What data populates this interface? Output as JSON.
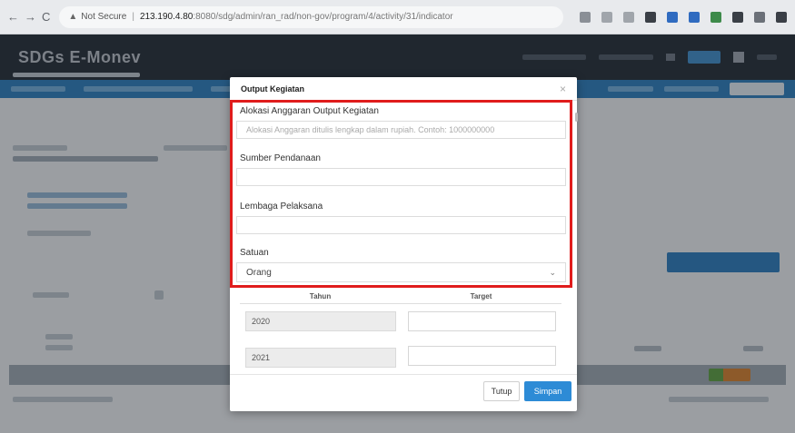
{
  "browser": {
    "back": "←",
    "forward": "→",
    "reload": "C",
    "security_label": "Not Secure",
    "host": "213.190.4.80",
    "path": ":8080/sdg/admin/ran_rad/non-gov/program/4/activity/31/indicator"
  },
  "app": {
    "brand": "SDGs E-Monev"
  },
  "modal": {
    "title": "Output Kegiatan",
    "close_icon": "×",
    "fields": {
      "alokasi_label": "Alokasi Anggaran Output Kegiatan",
      "alokasi_placeholder": "Alokasi Anggaran ditulis lengkap dalam rupiah. Contoh: 1000000000",
      "sumber_label": "Sumber Pendanaan",
      "lembaga_label": "Lembaga Pelaksana",
      "satuan_label": "Satuan",
      "satuan_value": "Orang"
    },
    "table": {
      "col_tahun": "Tahun",
      "col_target": "Target",
      "rows": [
        {
          "tahun": "2020"
        },
        {
          "tahun": "2021"
        }
      ]
    },
    "buttons": {
      "tutup": "Tutup",
      "simpan": "Simpan"
    }
  },
  "colors": {
    "highlight": "#e01c1c",
    "primary": "#2d8bd6",
    "header": "#232a35",
    "nav": "#2a7ab9"
  }
}
